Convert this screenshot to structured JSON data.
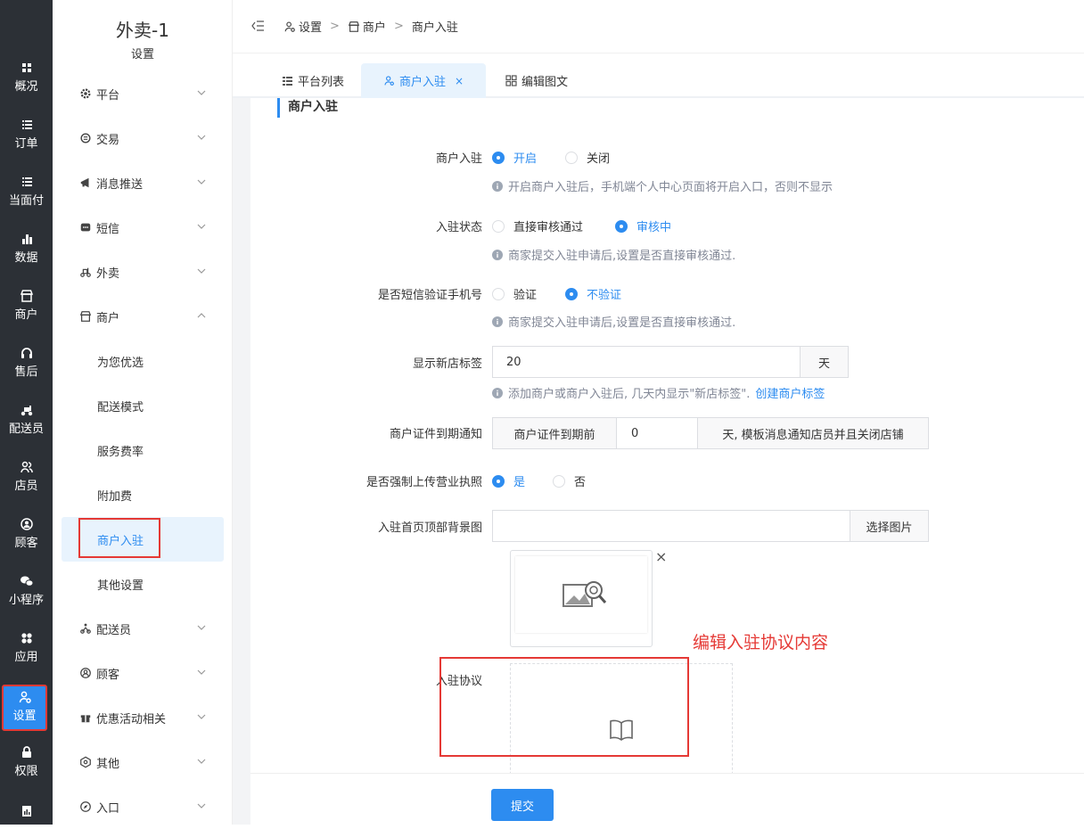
{
  "rail": [
    {
      "label": "概况",
      "icon": "dashboard-icon"
    },
    {
      "label": "订单",
      "icon": "list-icon"
    },
    {
      "label": "当面付",
      "icon": "list-icon"
    },
    {
      "label": "数据",
      "icon": "bar-chart-icon"
    },
    {
      "label": "商户",
      "icon": "store-icon"
    },
    {
      "label": "售后",
      "icon": "headset-icon"
    },
    {
      "label": "配送员",
      "icon": "scooter-icon"
    },
    {
      "label": "店员",
      "icon": "users-icon"
    },
    {
      "label": "顾客",
      "icon": "user-circle-icon"
    },
    {
      "label": "小程序",
      "icon": "wechat-icon"
    },
    {
      "label": "应用",
      "icon": "apps-icon"
    },
    {
      "label": "设置",
      "icon": "user-settings-icon"
    },
    {
      "label": "权限",
      "icon": "lock-icon"
    }
  ],
  "sidebar": {
    "app_title": "外卖-1",
    "app_subtitle": "设置",
    "groups": [
      {
        "label": "平台",
        "icon": "gear-icon"
      },
      {
        "label": "交易",
        "icon": "trade-icon"
      },
      {
        "label": "消息推送",
        "icon": "megaphone-icon"
      },
      {
        "label": "短信",
        "icon": "sms-icon"
      },
      {
        "label": "外卖",
        "icon": "scooter-icon"
      },
      {
        "label": "商户",
        "icon": "store-icon"
      }
    ],
    "merchant_items": [
      "为您优选",
      "配送模式",
      "服务费率",
      "附加费",
      "商户入驻",
      "其他设置"
    ],
    "groups_after": [
      {
        "label": "配送员",
        "icon": "courier-icon"
      },
      {
        "label": "顾客",
        "icon": "user-circle-icon"
      },
      {
        "label": "优惠活动相关",
        "icon": "gift-icon"
      },
      {
        "label": "其他",
        "icon": "hexagon-icon"
      },
      {
        "label": "入口",
        "icon": "compass-icon"
      }
    ]
  },
  "breadcrumb": [
    "设置",
    "商户",
    "商户入驻"
  ],
  "tabs": [
    {
      "label": "平台列表",
      "icon": "list-icon"
    },
    {
      "label": "商户入驻",
      "icon": "user-settings-icon",
      "close": "×"
    },
    {
      "label": "编辑图文",
      "icon": "grid-icon"
    }
  ],
  "section_title": "商户入驻",
  "form": {
    "enable": {
      "label": "商户入驻",
      "options": [
        "开启",
        "关闭"
      ],
      "selected": "开启",
      "tip": "开启商户入驻后，手机端个人中心页面将开启入口，否则不显示"
    },
    "status": {
      "label": "入驻状态",
      "options": [
        "直接审核通过",
        "审核中"
      ],
      "selected": "审核中",
      "tip": "商家提交入驻申请后,设置是否直接审核通过."
    },
    "sms": {
      "label": "是否短信验证手机号",
      "options": [
        "验证",
        "不验证"
      ],
      "selected": "不验证",
      "tip": "商家提交入驻申请后,设置是否直接审核通过."
    },
    "new_tag": {
      "label": "显示新店标签",
      "value": "20",
      "unit": "天",
      "tip": "添加商户或商户入驻后, 几天内显示\"新店标签\".",
      "tip_link": "创建商户标签"
    },
    "cert": {
      "label": "商户证件到期通知",
      "prefix": "商户证件到期前",
      "value": "0",
      "suffix": "天, 模板消息通知店员并且关闭店铺"
    },
    "license": {
      "label": "是否强制上传营业执照",
      "options": [
        "是",
        "否"
      ],
      "selected": "是"
    },
    "bg": {
      "label": "入驻首页顶部背景图",
      "value": "",
      "button": "选择图片",
      "close": "×"
    },
    "agreement": {
      "label": "入驻协议"
    }
  },
  "annotation": "编辑入驻协议内容",
  "submit_label": "提交",
  "colors": {
    "primary": "#2d8cf0",
    "rail_bg": "#2c3036",
    "highlight": "#e53935"
  }
}
